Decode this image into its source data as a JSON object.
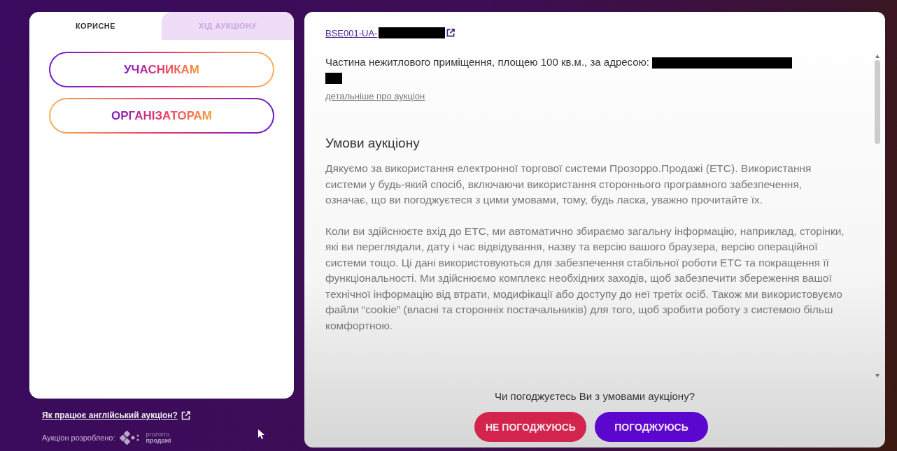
{
  "tabs": [
    {
      "label": "КОРИСНЕ",
      "selected": true
    },
    {
      "label": "ХІД АУКЦІОНУ",
      "selected": false
    }
  ],
  "role_buttons": [
    {
      "label": "УЧАСНИКАМ",
      "kind": "forward"
    },
    {
      "label": "ОРГАНІЗАТОРАМ",
      "kind": "reverse"
    }
  ],
  "help_link": "Як працює англійський аукціон?",
  "credit": {
    "label": "Аукціон розроблено:",
    "logo_top": "prozorro",
    "logo_bottom": "продажі"
  },
  "auction": {
    "id_link": "BSE001-UA-",
    "description": "Частина нежитлового приміщення, площею 100 кв.м., за адресою:",
    "details_link": "детальніше про аукціон",
    "terms_title": "Умови аукціону",
    "paragraphs": [
      "Дякуємо за використання електронної торгової системи Прозорро.Продажі (ЕТС). Використання системи у будь-який спосіб, включаючи використання стороннього програмного забезпечення, означає, що ви погоджуєтеся з цими умовами, тому, будь ласка, уважно прочитайте їх.",
      "Коли ви здійснюєте вхід до ЕТС, ми автоматично збираємо загальну інформацію, наприклад, сторінки, які ви переглядали, дату і час відвідування, назву та версію вашого браузера, версію операційної системи тощо. Ці дані використовуються для забезпечення стабільної роботи ЕТС та покращення її функціональності. Ми здійснюємо комплекс необхідних заходів, щоб забезпечити збереження вашої технічної інформацію від втрати, модифікації або доступу до неї третіх осіб. Також ми використовуємо файли “cookie” (власні та сторонніх постачальників) для того, щоб зробити роботу з системою більш комфортною."
    ]
  },
  "prompt": "Чи погоджуєтесь Ви з умовами аукціону?",
  "buttons": [
    {
      "label": "НЕ ПОГОДЖУЮСЬ",
      "kind": "decline"
    },
    {
      "label": "ПОГОДЖУЮСЬ",
      "kind": "accept"
    }
  ]
}
